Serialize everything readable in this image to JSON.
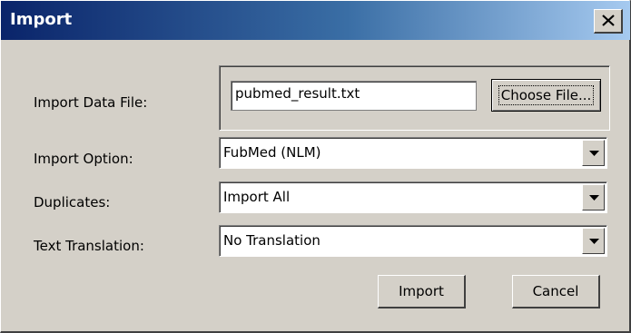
{
  "window": {
    "title": "Import"
  },
  "form": {
    "import_data_file": {
      "label": "Import Data File:",
      "value": "pubmed_result.txt",
      "button_label": "Choose File..."
    },
    "import_option": {
      "label": "Import Option:",
      "value": "FubMed (NLM)"
    },
    "duplicates": {
      "label": "Duplicates:",
      "value": "Import All"
    },
    "text_translation": {
      "label": "Text Translation:",
      "value": "No Translation"
    }
  },
  "actions": {
    "import_label": "Import",
    "cancel_label": "Cancel"
  },
  "icons": {
    "close": "close-icon",
    "dropdown": "chevron-down-icon"
  },
  "colors": {
    "title_start": "#0a246a",
    "title_end": "#a6caf0",
    "face": "#d4d0c8"
  }
}
